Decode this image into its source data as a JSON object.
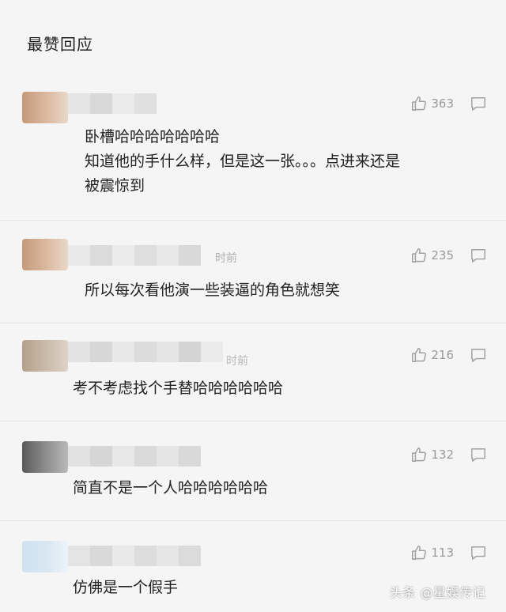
{
  "header": {
    "title": "最赞回应"
  },
  "comments": [
    {
      "text_lines": [
        "卧槽哈哈哈哈哈哈哈",
        "知道他的手什么样，但是这一张。。。点进来还是",
        "被震惊到"
      ],
      "likes": "363"
    },
    {
      "text_lines": [
        "所以每次看他演一些装逼的角色就想笑"
      ],
      "likes": "235",
      "time_fragment": "时前"
    },
    {
      "text_lines": [
        "考不考虑找个手替哈哈哈哈哈哈"
      ],
      "likes": "216",
      "time_fragment": "时前"
    },
    {
      "text_lines": [
        "简直不是一个人哈哈哈哈哈哈"
      ],
      "likes": "132"
    },
    {
      "text_lines": [
        "仿佛是一个假手"
      ],
      "likes": "113"
    }
  ],
  "watermark": "头条 @星娱传记",
  "icons": {
    "like": "thumbs-up-icon",
    "reply": "comment-icon"
  }
}
